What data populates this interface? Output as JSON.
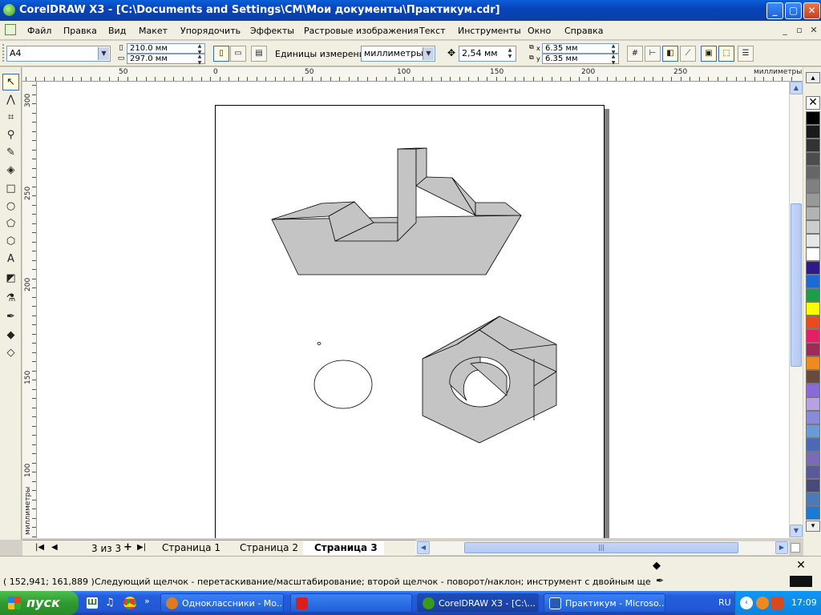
{
  "window": {
    "title": "CorelDRAW X3 - [C:\\Documents and Settings\\CM\\Мои документы\\Практикум.cdr]",
    "min_symbol": "_",
    "max_symbol": "▢",
    "close_symbol": "✕"
  },
  "menu": {
    "items": [
      "Файл",
      "Правка",
      "Вид",
      "Макет",
      "Упорядочить",
      "Эффекты",
      "Растровые изображения",
      "Текст",
      "Инструменты",
      "Окно",
      "Справка"
    ],
    "mdi": [
      "_",
      "▫",
      "✕"
    ]
  },
  "propbar": {
    "paper_size": "A4",
    "width": "210.0 мм",
    "height": "297.0 мм",
    "units_label": "Единицы измерения:",
    "units_value": "миллиметры",
    "nudge": "2,54 мм",
    "dup_x_label": "x",
    "dup_y_label": "y",
    "dup_x": "6.35 мм",
    "dup_y": "6.35 мм"
  },
  "ruler": {
    "h_labels": [
      "50",
      "0",
      "50",
      "100",
      "150",
      "200",
      "250"
    ],
    "h_units": "миллиметры",
    "v_labels": [
      "300",
      "250",
      "200",
      "150",
      "100"
    ],
    "v_units": "миллиметры"
  },
  "tabs": {
    "counter": "3 из 3",
    "pages": [
      "Страница 1",
      "Страница 2",
      "Страница 3"
    ],
    "active_index": 2
  },
  "status": {
    "coords": "( 152,941; 161,889 )",
    "hint": "Следующий щелчок - перетаскивание/масштабирование; второй щелчок - поворот/наклон; инструмент с двойным щелчком выбира..."
  },
  "palette": {
    "colors": [
      "#000000",
      "#1a1a1a",
      "#333333",
      "#4d4d4d",
      "#666666",
      "#808080",
      "#999999",
      "#b3b3b3",
      "#cccccc",
      "#e6e6e6",
      "#ffffff",
      "#2e1a8a",
      "#1a6bd6",
      "#1a9e4a",
      "#ffff00",
      "#e84c1e",
      "#e61e64",
      "#9e2a5a",
      "#f08a1e",
      "#6a4a3a",
      "#8a6ad8",
      "#b9a0e0",
      "#8a8ad8",
      "#6a9ad8",
      "#4a6ab8",
      "#7a6ab8",
      "#5a5a9a",
      "#4a4a7a",
      "#4a7ab8",
      "#1a7ad8"
    ]
  },
  "taskbar": {
    "start": "пуск",
    "tasks": [
      {
        "label": "Одноклассники - Mo...",
        "color": "#e07a1e"
      },
      {
        "label": "",
        "color": "#d81e1e"
      },
      {
        "label": "CorelDRAW X3 - [C:\\...",
        "color": "#3a9a1a"
      },
      {
        "label": "Практикум - Microso...",
        "color": "#2a5ab8"
      }
    ],
    "lang": "RU",
    "clock": "17:09"
  }
}
